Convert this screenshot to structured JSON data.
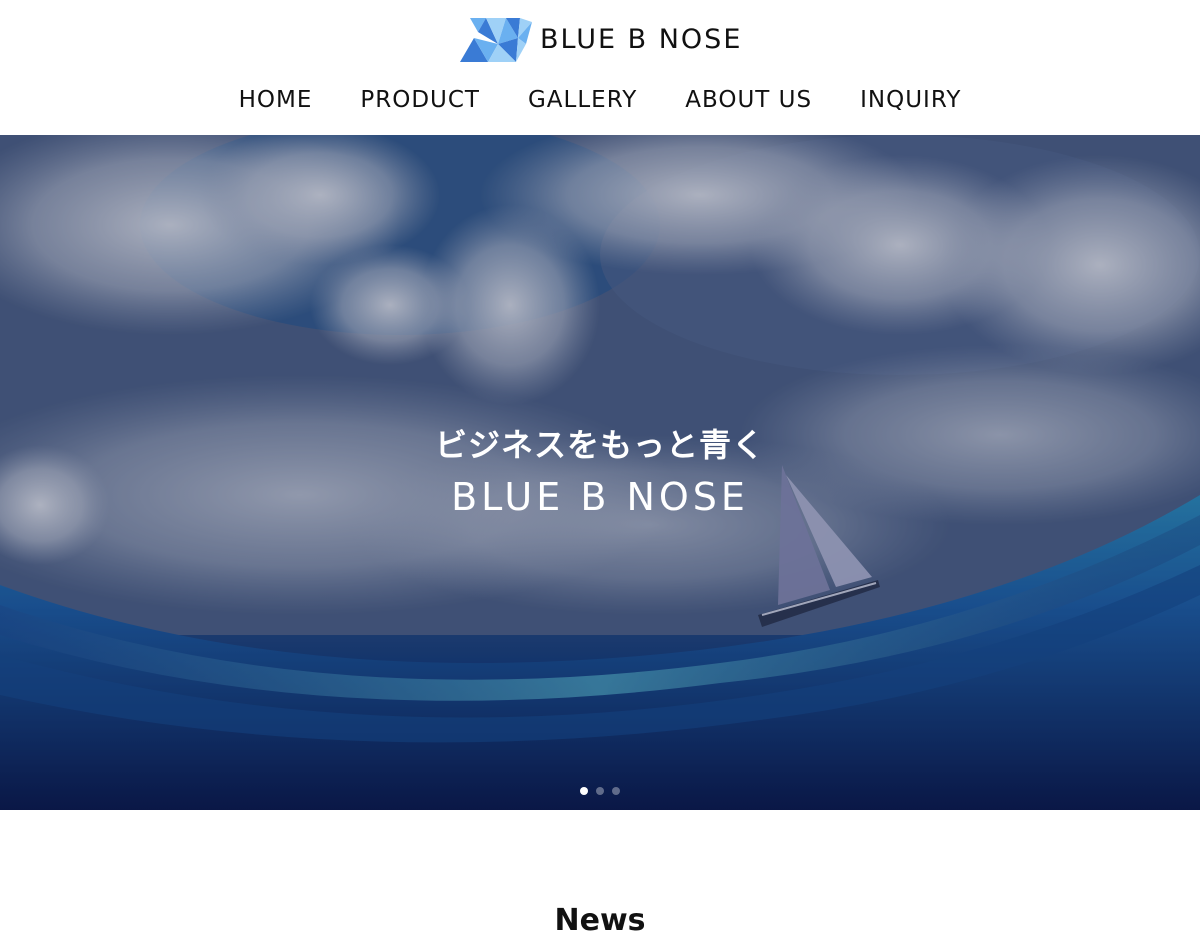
{
  "header": {
    "logo_text": "BLUE B NOSE",
    "logo_icon": "folded-paper-plane-logo",
    "brand_colors": [
      "#3a7bd5",
      "#6ab0f0",
      "#9fd1f7"
    ]
  },
  "nav": {
    "items": [
      {
        "label": "HOME"
      },
      {
        "label": "PRODUCT"
      },
      {
        "label": "GALLERY"
      },
      {
        "label": "ABOUT US"
      },
      {
        "label": "INQUIRY"
      }
    ]
  },
  "hero": {
    "tagline": "ビジネスをもっと青く",
    "title": "BLUE B NOSE",
    "slide_count": 3,
    "active_slide": 1
  },
  "news": {
    "heading": "News"
  }
}
